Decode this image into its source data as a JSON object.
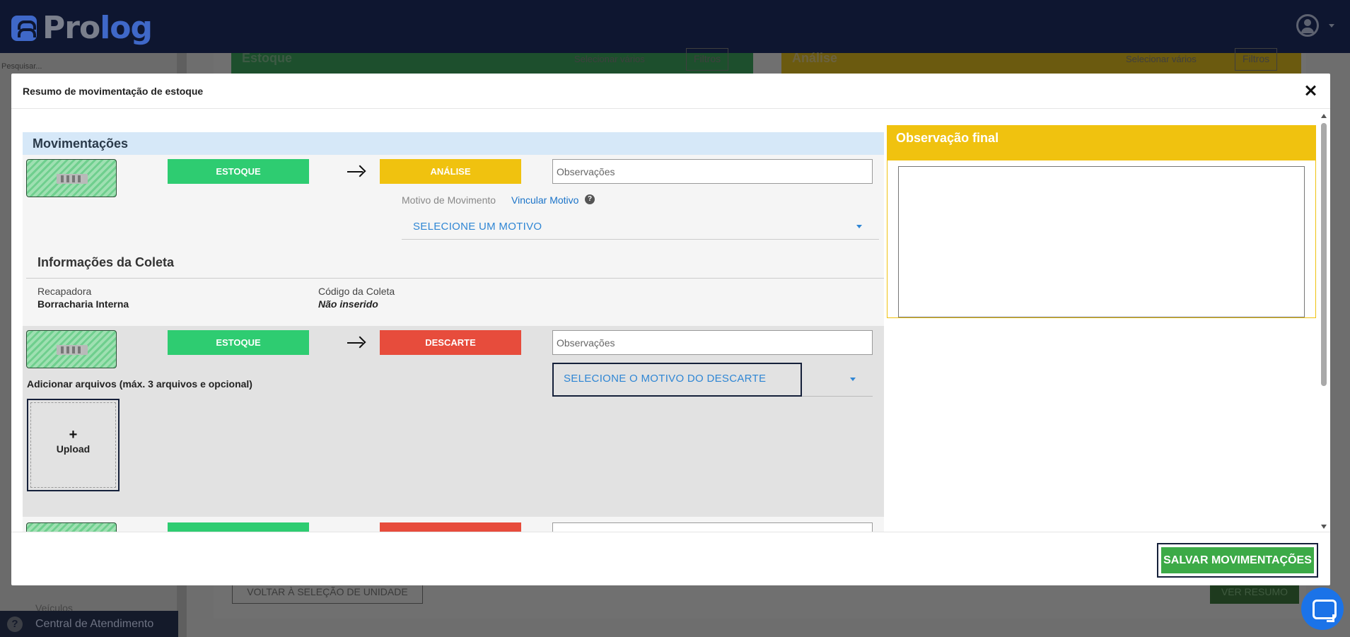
{
  "app": {
    "logo_pro": "Pro",
    "logo_log": "log"
  },
  "sidebar": {
    "search_placeholder": "Pesquisar...",
    "item_veiculos": "Veículos",
    "help_label": "Central de Atendimento"
  },
  "background": {
    "col_estoque": "Estoque",
    "col_analise": "Análise",
    "select_many": "Selecionar vários",
    "filters": "Filtros",
    "back_button": "VOLTAR À SELEÇÃO DE UNIDADE",
    "summary_button": "VER RESUMO"
  },
  "modal": {
    "title": "Resumo de movimentação de estoque",
    "movements_header": "Movimentações",
    "row1": {
      "from": "ESTOQUE",
      "to": "ANÁLISE",
      "obs_placeholder": "Observações",
      "motivo_label": "Motivo de Movimento",
      "vincular_link": "Vincular Motivo",
      "help_icon": "?",
      "select_value": "SELECIONE UM MOTIVO"
    },
    "coleta": {
      "title": "Informações da Coleta",
      "recapadora_label": "Recapadora",
      "recapadora_value": "Borracharia Interna",
      "codigo_label": "Código da Coleta",
      "codigo_value": "Não inserido"
    },
    "row2": {
      "from": "ESTOQUE",
      "to": "DESCARTE",
      "obs_placeholder": "Observações",
      "select_value": "SELECIONE O MOTIVO DO DESCARTE",
      "files_label": "Adicionar arquivos (máx. 3 arquivos e opcional)",
      "upload_plus": "+",
      "upload_label": "Upload"
    },
    "obs_final_title": "Observação final",
    "save_button": "SALVAR MOVIMENTAÇÕES"
  },
  "colors": {
    "green_status": "#2ecc71",
    "yellow_status": "#f0c20f",
    "red_status": "#e74c3c",
    "link_blue": "#1a73c8",
    "save_green": "#3caa47",
    "topbar": "#0e1630"
  }
}
